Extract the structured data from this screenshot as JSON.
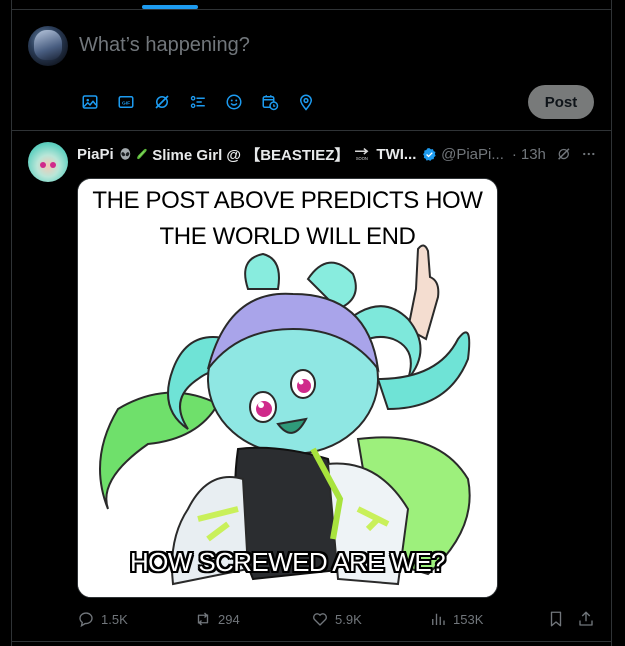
{
  "composer": {
    "placeholder": "What’s happening?",
    "tools": [
      {
        "icon": "image-icon"
      },
      {
        "icon": "gif-icon",
        "label": "GIF"
      },
      {
        "icon": "grok-icon"
      },
      {
        "icon": "poll-icon"
      },
      {
        "icon": "emoji-icon"
      },
      {
        "icon": "schedule-icon"
      },
      {
        "icon": "location-icon"
      }
    ],
    "post_label": "Post"
  },
  "tweet": {
    "display_name_part1": "PiaPi",
    "display_name_part2": "Slime Girl @ 【BEASTIEZ】",
    "display_name_part3": "TWI...",
    "handle": "@PiaPi...",
    "separator": "·",
    "time": "13h",
    "emoji_soon_label": "SOON",
    "media": {
      "top_text": "THE POST ABOVE PREDICTS HOW THE WORLD WILL END",
      "bottom_text": "HOW SCREWED ARE WE?"
    },
    "actions": {
      "replies": "1.5K",
      "reposts": "294",
      "likes": "5.9K",
      "views": "153K"
    }
  },
  "colors": {
    "background": "#000000",
    "accent": "#1d9bf0",
    "muted_text": "#71767b",
    "post_button": "#787a7a",
    "divider": "#2f3336"
  }
}
